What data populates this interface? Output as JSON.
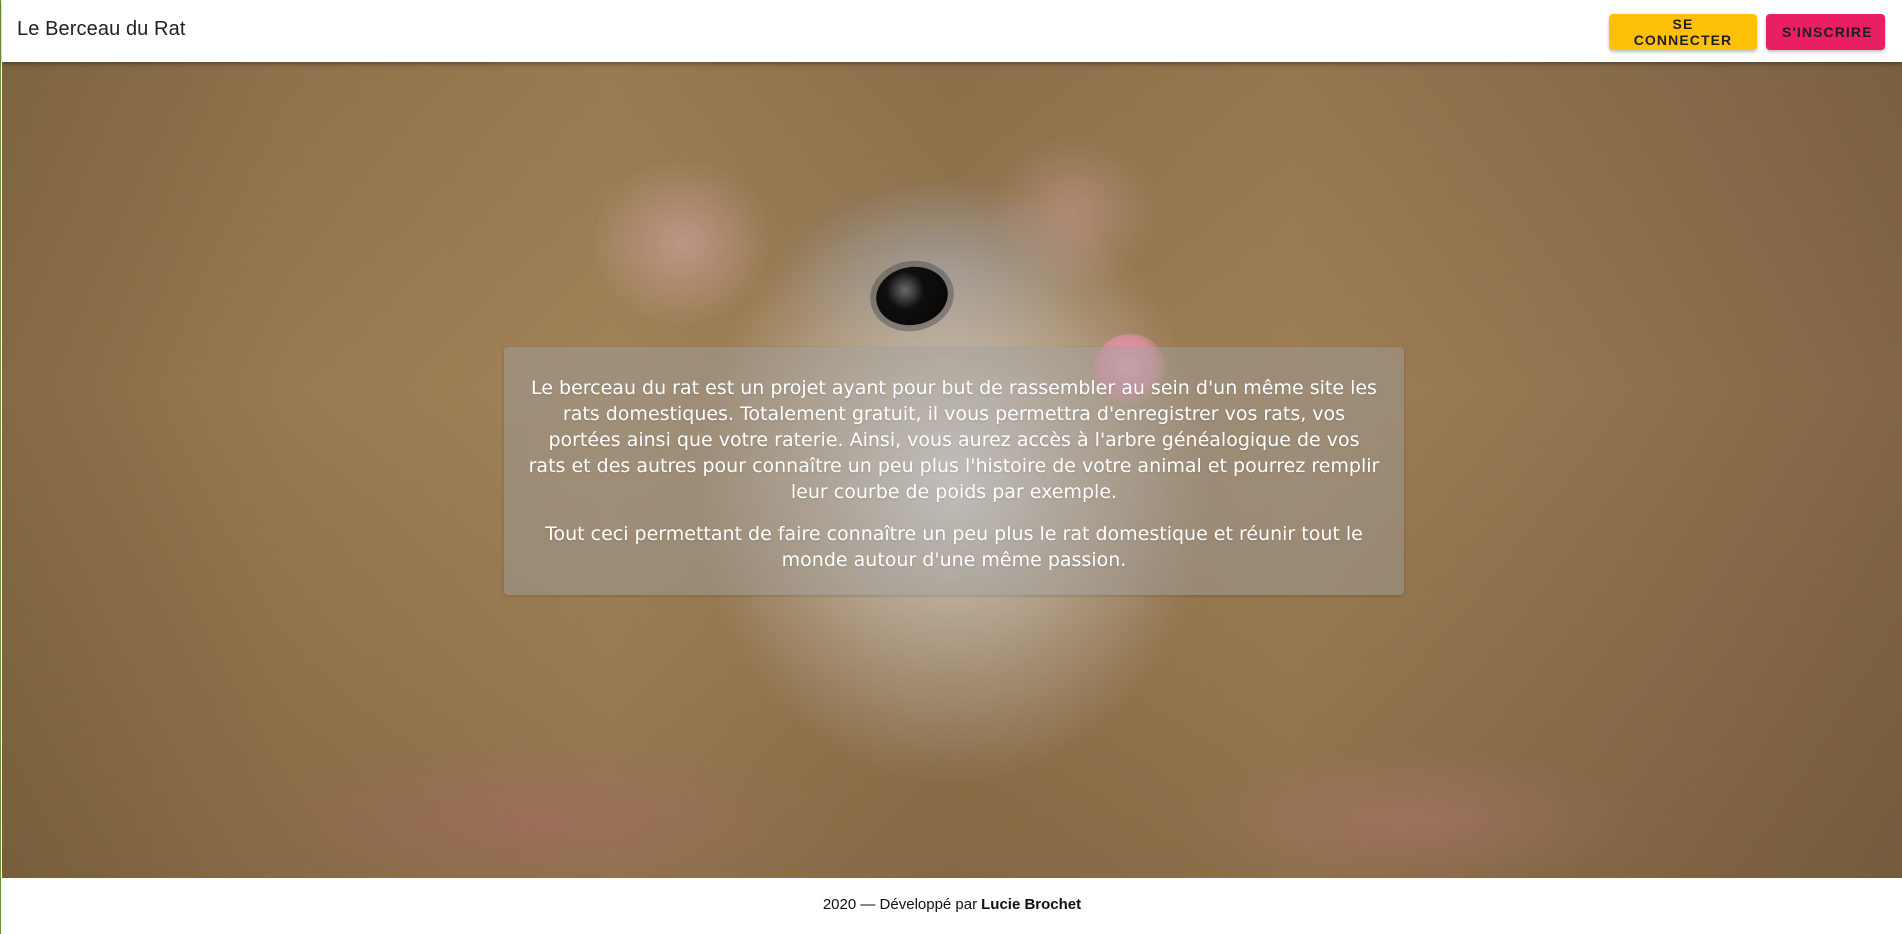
{
  "header": {
    "brand": "Le Berceau du Rat",
    "login_label": "Se connecter",
    "register_label": "S'inscrire"
  },
  "hero": {
    "paragraphs": [
      "Le berceau du rat est un projet ayant pour but de rassembler au sein d'un même site les rats domestiques. Totalement gratuit, il vous permettra d'enregistrer vos rats, vos portées ainsi que votre raterie. Ainsi, vous aurez accès à l'arbre généalogique de vos rats et des autres pour connaître un peu plus l'histoire de votre animal et pourrez remplir leur courbe de poids par exemple.",
      "Tout ceci permettant de faire connaître un peu plus le rat domestique et réunir tout le monde autour d'une même passion."
    ],
    "image_label": "rat-photo"
  },
  "footer": {
    "prefix": "2020 — Développé par",
    "author": "Lucie Brochet"
  },
  "colors": {
    "login_button": "#ffc107",
    "register_button": "#e91e63",
    "header_background": "#ffffff",
    "card_background": "rgba(160,160,160,0.45)"
  }
}
